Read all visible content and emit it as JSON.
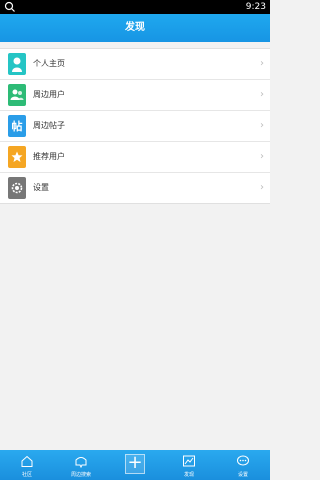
{
  "statusbar": {
    "time": "9:23",
    "search_icon": "search-icon"
  },
  "header": {
    "title": "发现"
  },
  "menu": {
    "items": [
      {
        "label": "个人主页",
        "icon": "person-icon",
        "color": "#25c5c5"
      },
      {
        "label": "周边用户",
        "icon": "users-icon",
        "color": "#2dbb76"
      },
      {
        "label": "周边帖子",
        "icon": "post-icon",
        "color": "#2a9de8"
      },
      {
        "label": "推荐用户",
        "icon": "star-icon",
        "color": "#f5a623"
      },
      {
        "label": "设置",
        "icon": "gear-icon",
        "color": "#777777"
      }
    ]
  },
  "tabbar": {
    "items": [
      {
        "label": "社区",
        "icon": "home-icon"
      },
      {
        "label": "周边搜索",
        "icon": "nearby-icon"
      },
      {
        "label": "",
        "icon": "plus-icon"
      },
      {
        "label": "发现",
        "icon": "discover-icon"
      },
      {
        "label": "设置",
        "icon": "settings-chat-icon"
      }
    ]
  }
}
